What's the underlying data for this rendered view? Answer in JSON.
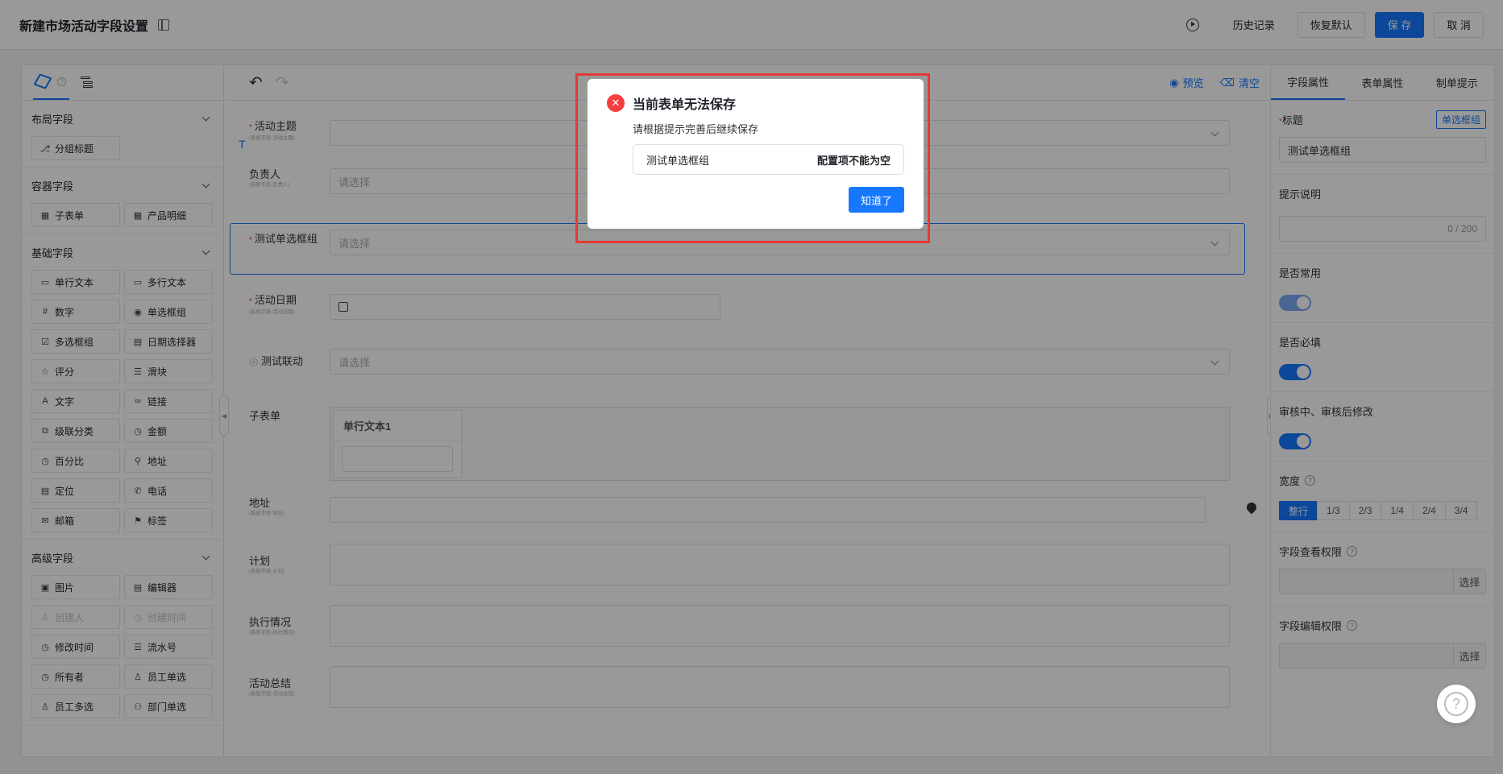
{
  "header": {
    "title": "新建市场活动字段设置",
    "history": "历史记录",
    "restore": "恢复默认",
    "save": "保 存",
    "cancel": "取 消"
  },
  "left_panel": {
    "sections": [
      {
        "title": "布局字段",
        "items": [
          {
            "label": "分组标题",
            "icon": "group-icon"
          }
        ]
      },
      {
        "title": "容器字段",
        "items": [
          {
            "label": "子表单",
            "icon": "table-icon"
          },
          {
            "label": "产品明细",
            "icon": "table-icon"
          }
        ]
      },
      {
        "title": "基础字段",
        "items": [
          {
            "label": "单行文本",
            "icon": "input-icon"
          },
          {
            "label": "多行文本",
            "icon": "textarea-icon"
          },
          {
            "label": "数字",
            "icon": "number-icon"
          },
          {
            "label": "单选框组",
            "icon": "radio-icon"
          },
          {
            "label": "多选框组",
            "icon": "checkbox-icon"
          },
          {
            "label": "日期选择器",
            "icon": "calendar-icon"
          },
          {
            "label": "评分",
            "icon": "star-icon"
          },
          {
            "label": "滑块",
            "icon": "slider-icon"
          },
          {
            "label": "文字",
            "icon": "text-icon"
          },
          {
            "label": "链接",
            "icon": "link-icon"
          },
          {
            "label": "级联分类",
            "icon": "cascade-icon"
          },
          {
            "label": "金额",
            "icon": "money-icon"
          },
          {
            "label": "百分比",
            "icon": "percent-icon"
          },
          {
            "label": "地址",
            "icon": "location-icon"
          },
          {
            "label": "定位",
            "icon": "document-icon"
          },
          {
            "label": "电话",
            "icon": "phone-icon"
          },
          {
            "label": "邮箱",
            "icon": "mail-icon"
          },
          {
            "label": "标签",
            "icon": "tag-icon"
          }
        ]
      },
      {
        "title": "高级字段",
        "items": [
          {
            "label": "图片",
            "icon": "image-icon"
          },
          {
            "label": "编辑器",
            "icon": "editor-icon"
          },
          {
            "label": "创建人",
            "icon": "user-icon",
            "disabled": true
          },
          {
            "label": "创建时间",
            "icon": "clock-icon",
            "disabled": true
          },
          {
            "label": "修改时间",
            "icon": "clock-icon"
          },
          {
            "label": "流水号",
            "icon": "list-icon"
          },
          {
            "label": "所有者",
            "icon": "clock-icon"
          },
          {
            "label": "员工单选",
            "icon": "user-icon"
          },
          {
            "label": "员工多选",
            "icon": "users-icon"
          },
          {
            "label": "部门单选",
            "icon": "org-icon"
          }
        ]
      }
    ]
  },
  "toolbar": {
    "preview": "预览",
    "clear": "清空"
  },
  "form": {
    "fields": [
      {
        "label": "活动主题",
        "sub": "(系统字段·活动主题)",
        "required": true,
        "placeholder": ""
      },
      {
        "label": "负责人",
        "sub": "(系统字段·负责人)",
        "required": false,
        "placeholder": "请选择"
      },
      {
        "label": "测试单选框组",
        "sub": "",
        "required": true,
        "placeholder": "请选择"
      },
      {
        "label": "活动日期",
        "sub": "(系统字段·活动日期)",
        "required": true,
        "placeholder": ""
      },
      {
        "label": "测试联动",
        "sub": "",
        "required": false,
        "placeholder": "请选择"
      },
      {
        "label": "子表单",
        "sub": "",
        "required": false,
        "placeholder": ""
      },
      {
        "label": "地址",
        "sub": "(系统字段·地址)",
        "required": false,
        "placeholder": ""
      },
      {
        "label": "计划",
        "sub": "(系统字段·计划)",
        "required": false,
        "placeholder": ""
      },
      {
        "label": "执行情况",
        "sub": "(系统字段·执行情况)",
        "required": false,
        "placeholder": ""
      },
      {
        "label": "活动总结",
        "sub": "(系统字段·活动总结)",
        "required": false,
        "placeholder": ""
      }
    ],
    "subtable_col": "单行文本1"
  },
  "right_panel": {
    "tabs": [
      "字段属性",
      "表单属性",
      "制单提示"
    ],
    "title_label": "标题",
    "title_tag": "单选框组",
    "title_value": "测试单选框组",
    "hint_label": "提示说明",
    "hint_count": "0 / 200",
    "common_label": "是否常用",
    "required_label": "是否必填",
    "modify_label": "审核中、审核后修改",
    "width_label": "宽度",
    "widths": [
      "整行",
      "1/3",
      "2/3",
      "1/4",
      "2/4",
      "3/4"
    ],
    "view_perm_label": "字段查看权限",
    "edit_perm_label": "字段编辑权限",
    "select_btn": "选择"
  },
  "modal": {
    "title": "当前表单无法保存",
    "desc": "请根据提示完善后继续保存",
    "error_field": "测试单选框组",
    "error_msg": "配置项不能为空",
    "ok": "知道了"
  }
}
